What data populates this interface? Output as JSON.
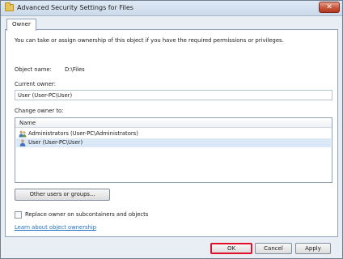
{
  "window": {
    "title": "Advanced Security Settings for Files",
    "close_glyph": "✕"
  },
  "tabs": [
    {
      "label": "Owner"
    }
  ],
  "owner": {
    "intro": "You can take or assign ownership of this object if you have the required permissions or privileges.",
    "object_name_label": "Object name:",
    "object_name_value": "D:\\Files",
    "current_owner_label": "Current owner:",
    "current_owner_value": "User (User-PC\\User)",
    "change_owner_label": "Change owner to:",
    "list": {
      "column": "Name",
      "items": [
        {
          "label": "Administrators (User-PC\\Administrators)",
          "icon": "group-icon"
        },
        {
          "label": "User (User-PC\\User)",
          "icon": "user-icon",
          "selected": true
        }
      ]
    },
    "other_users_button": "Other users or groups...",
    "replace_checkbox_label": "Replace owner on subcontainers and objects",
    "replace_checked": false,
    "learn_link": "Learn about object ownership"
  },
  "buttons": {
    "ok": "OK",
    "cancel": "Cancel",
    "apply": "Apply"
  },
  "colors": {
    "ok_highlight": "#e0102a",
    "link": "#1f6fc2",
    "selection": "#dbe8f7"
  }
}
